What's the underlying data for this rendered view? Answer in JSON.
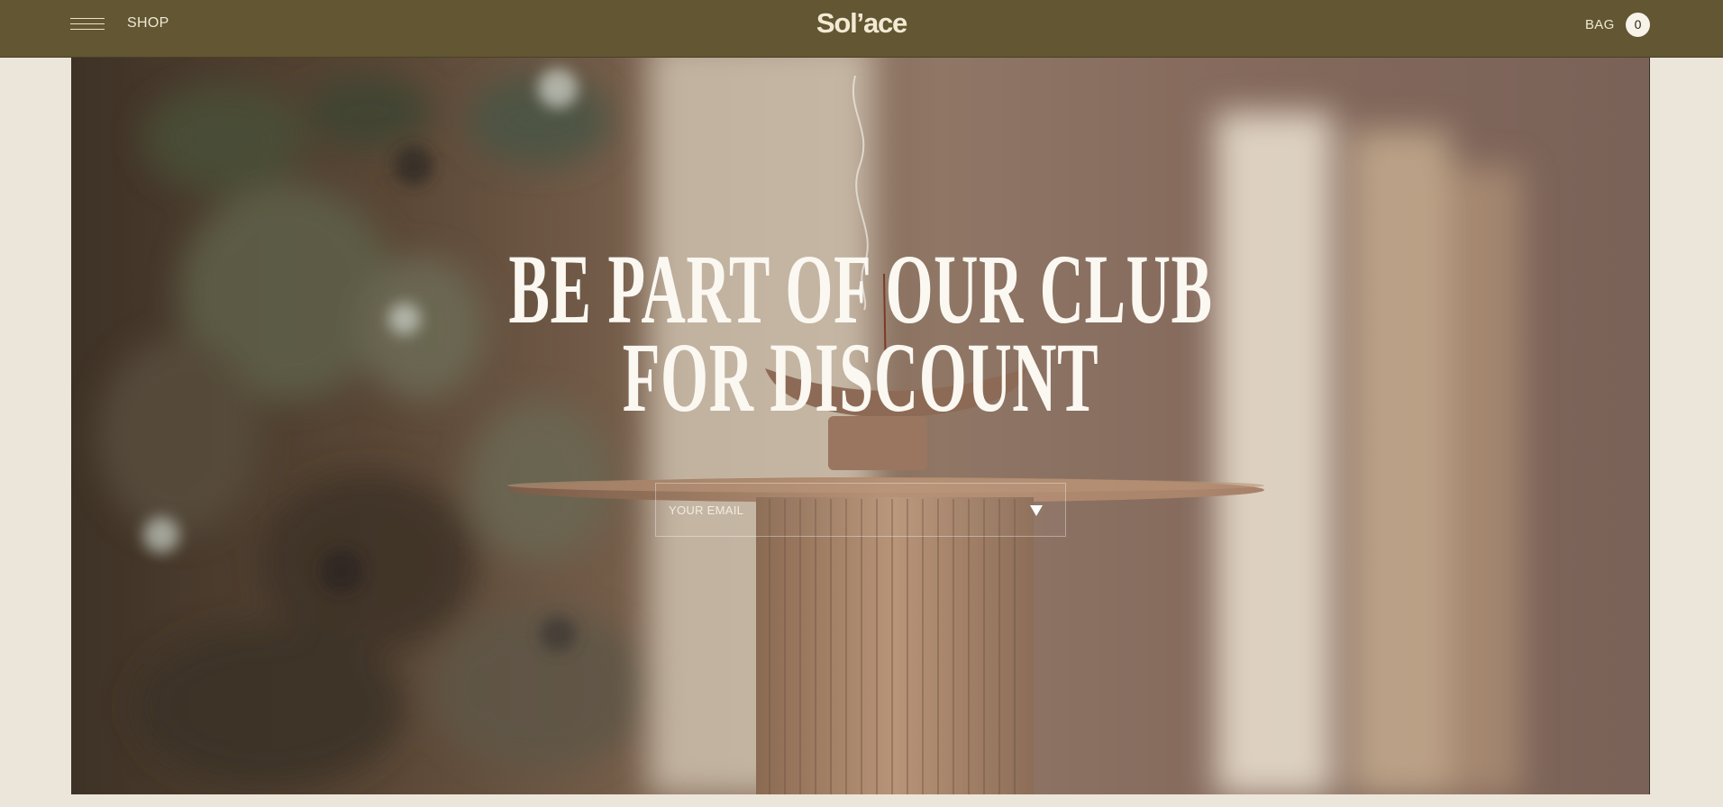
{
  "header": {
    "shop_label": "SHOP",
    "logo": "Sol’ace",
    "bag_label": "BAG",
    "bag_count": "0"
  },
  "hero": {
    "headline_line1": "BE PART OF OUR CLUB",
    "headline_line2": "FOR DISCOUNT",
    "email_placeholder": "YOUR EMAIL"
  },
  "colors": {
    "header_bg": "#625633",
    "page_bg": "#ebe6d9",
    "headline_text": "#fbf8f2"
  },
  "icons": {
    "menu": "hamburger-icon",
    "submit": "triangle-down-icon"
  }
}
